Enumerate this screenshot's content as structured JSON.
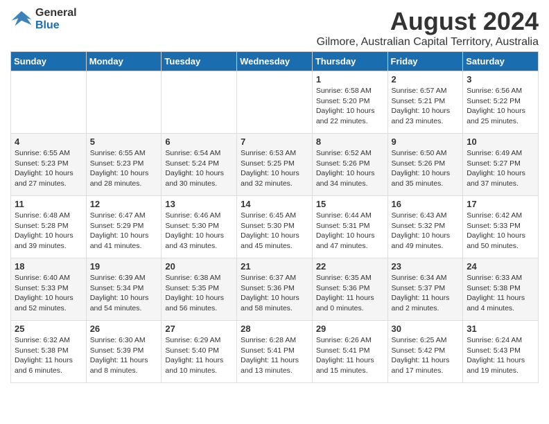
{
  "logo": {
    "line1": "General",
    "line2": "Blue"
  },
  "title": "August 2024",
  "subtitle": "Gilmore, Australian Capital Territory, Australia",
  "weekdays": [
    "Sunday",
    "Monday",
    "Tuesday",
    "Wednesday",
    "Thursday",
    "Friday",
    "Saturday"
  ],
  "weeks": [
    [
      {
        "day": "",
        "info": ""
      },
      {
        "day": "",
        "info": ""
      },
      {
        "day": "",
        "info": ""
      },
      {
        "day": "",
        "info": ""
      },
      {
        "day": "1",
        "info": "Sunrise: 6:58 AM\nSunset: 5:20 PM\nDaylight: 10 hours\nand 22 minutes."
      },
      {
        "day": "2",
        "info": "Sunrise: 6:57 AM\nSunset: 5:21 PM\nDaylight: 10 hours\nand 23 minutes."
      },
      {
        "day": "3",
        "info": "Sunrise: 6:56 AM\nSunset: 5:22 PM\nDaylight: 10 hours\nand 25 minutes."
      }
    ],
    [
      {
        "day": "4",
        "info": "Sunrise: 6:55 AM\nSunset: 5:23 PM\nDaylight: 10 hours\nand 27 minutes."
      },
      {
        "day": "5",
        "info": "Sunrise: 6:55 AM\nSunset: 5:23 PM\nDaylight: 10 hours\nand 28 minutes."
      },
      {
        "day": "6",
        "info": "Sunrise: 6:54 AM\nSunset: 5:24 PM\nDaylight: 10 hours\nand 30 minutes."
      },
      {
        "day": "7",
        "info": "Sunrise: 6:53 AM\nSunset: 5:25 PM\nDaylight: 10 hours\nand 32 minutes."
      },
      {
        "day": "8",
        "info": "Sunrise: 6:52 AM\nSunset: 5:26 PM\nDaylight: 10 hours\nand 34 minutes."
      },
      {
        "day": "9",
        "info": "Sunrise: 6:50 AM\nSunset: 5:26 PM\nDaylight: 10 hours\nand 35 minutes."
      },
      {
        "day": "10",
        "info": "Sunrise: 6:49 AM\nSunset: 5:27 PM\nDaylight: 10 hours\nand 37 minutes."
      }
    ],
    [
      {
        "day": "11",
        "info": "Sunrise: 6:48 AM\nSunset: 5:28 PM\nDaylight: 10 hours\nand 39 minutes."
      },
      {
        "day": "12",
        "info": "Sunrise: 6:47 AM\nSunset: 5:29 PM\nDaylight: 10 hours\nand 41 minutes."
      },
      {
        "day": "13",
        "info": "Sunrise: 6:46 AM\nSunset: 5:30 PM\nDaylight: 10 hours\nand 43 minutes."
      },
      {
        "day": "14",
        "info": "Sunrise: 6:45 AM\nSunset: 5:30 PM\nDaylight: 10 hours\nand 45 minutes."
      },
      {
        "day": "15",
        "info": "Sunrise: 6:44 AM\nSunset: 5:31 PM\nDaylight: 10 hours\nand 47 minutes."
      },
      {
        "day": "16",
        "info": "Sunrise: 6:43 AM\nSunset: 5:32 PM\nDaylight: 10 hours\nand 49 minutes."
      },
      {
        "day": "17",
        "info": "Sunrise: 6:42 AM\nSunset: 5:33 PM\nDaylight: 10 hours\nand 50 minutes."
      }
    ],
    [
      {
        "day": "18",
        "info": "Sunrise: 6:40 AM\nSunset: 5:33 PM\nDaylight: 10 hours\nand 52 minutes."
      },
      {
        "day": "19",
        "info": "Sunrise: 6:39 AM\nSunset: 5:34 PM\nDaylight: 10 hours\nand 54 minutes."
      },
      {
        "day": "20",
        "info": "Sunrise: 6:38 AM\nSunset: 5:35 PM\nDaylight: 10 hours\nand 56 minutes."
      },
      {
        "day": "21",
        "info": "Sunrise: 6:37 AM\nSunset: 5:36 PM\nDaylight: 10 hours\nand 58 minutes."
      },
      {
        "day": "22",
        "info": "Sunrise: 6:35 AM\nSunset: 5:36 PM\nDaylight: 11 hours\nand 0 minutes."
      },
      {
        "day": "23",
        "info": "Sunrise: 6:34 AM\nSunset: 5:37 PM\nDaylight: 11 hours\nand 2 minutes."
      },
      {
        "day": "24",
        "info": "Sunrise: 6:33 AM\nSunset: 5:38 PM\nDaylight: 11 hours\nand 4 minutes."
      }
    ],
    [
      {
        "day": "25",
        "info": "Sunrise: 6:32 AM\nSunset: 5:38 PM\nDaylight: 11 hours\nand 6 minutes."
      },
      {
        "day": "26",
        "info": "Sunrise: 6:30 AM\nSunset: 5:39 PM\nDaylight: 11 hours\nand 8 minutes."
      },
      {
        "day": "27",
        "info": "Sunrise: 6:29 AM\nSunset: 5:40 PM\nDaylight: 11 hours\nand 10 minutes."
      },
      {
        "day": "28",
        "info": "Sunrise: 6:28 AM\nSunset: 5:41 PM\nDaylight: 11 hours\nand 13 minutes."
      },
      {
        "day": "29",
        "info": "Sunrise: 6:26 AM\nSunset: 5:41 PM\nDaylight: 11 hours\nand 15 minutes."
      },
      {
        "day": "30",
        "info": "Sunrise: 6:25 AM\nSunset: 5:42 PM\nDaylight: 11 hours\nand 17 minutes."
      },
      {
        "day": "31",
        "info": "Sunrise: 6:24 AM\nSunset: 5:43 PM\nDaylight: 11 hours\nand 19 minutes."
      }
    ]
  ]
}
